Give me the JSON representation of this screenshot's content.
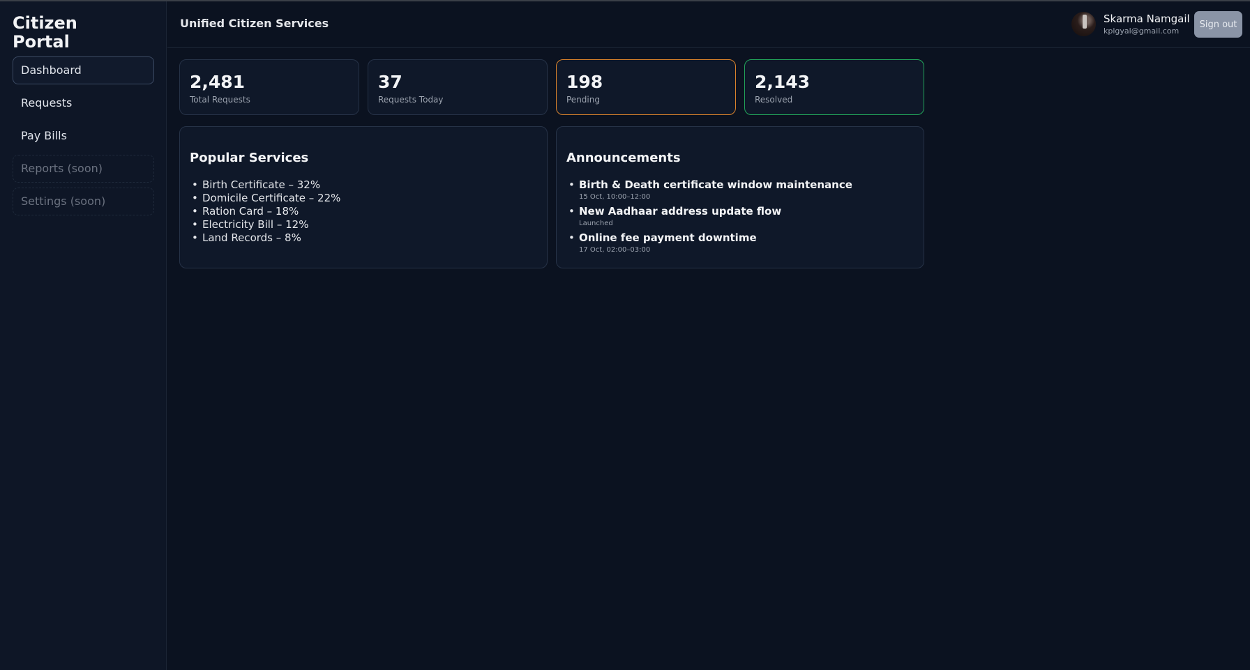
{
  "sidebar": {
    "brand": "Citizen Portal",
    "items": [
      {
        "label": "Dashboard"
      },
      {
        "label": "Requests"
      },
      {
        "label": "Pay Bills"
      },
      {
        "label": "Reports (soon)"
      },
      {
        "label": "Settings (soon)"
      }
    ]
  },
  "header": {
    "title": "Unified Citizen Services",
    "user": {
      "name": "Skarma Namgail",
      "email": "kplgyal@gmail.com"
    },
    "signout_label": "Sign out"
  },
  "stats": [
    {
      "value": "2,481",
      "label": "Total Requests"
    },
    {
      "value": "37",
      "label": "Requests Today"
    },
    {
      "value": "198",
      "label": "Pending",
      "accent": "#d9822b"
    },
    {
      "value": "2,143",
      "label": "Resolved",
      "accent": "#22a55a"
    }
  ],
  "popular_services": {
    "title": "Popular Services",
    "items": [
      "Birth Certificate – 32%",
      "Domicile Certificate – 22%",
      "Ration Card – 18%",
      "Electricity Bill – 12%",
      "Land Records – 8%"
    ]
  },
  "announcements": {
    "title": "Announcements",
    "items": [
      {
        "title": "Birth & Death certificate window maintenance",
        "detail": "15 Oct, 10:00–12:00"
      },
      {
        "title": "New Aadhaar address update flow",
        "detail": "Launched"
      },
      {
        "title": "Online fee payment downtime",
        "detail": "17 Oct, 02:00–03:00"
      }
    ]
  }
}
